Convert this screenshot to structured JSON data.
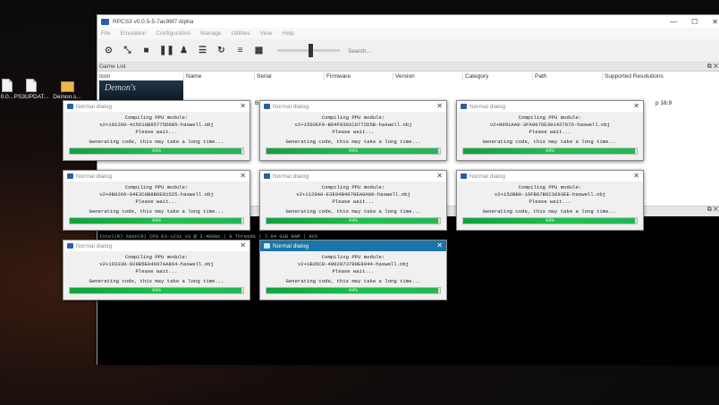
{
  "desktop": {
    "icons": [
      {
        "label": "0.0..."
      },
      {
        "label": "PS3UPDAT..."
      },
      {
        "label": "Demon.s..."
      }
    ]
  },
  "window": {
    "title": "RPCS3 v0.0.5-5-7ac96f7 Alpha",
    "controls": {
      "minimize": "—",
      "maximize": "☐",
      "close": "✕"
    }
  },
  "menu": [
    "File",
    "Emulation",
    "Configuration",
    "Manage",
    "Utilities",
    "View",
    "Help"
  ],
  "toolbar": {
    "search_placeholder": "Search...",
    "icons": [
      "open-icon",
      "fullscreen-icon",
      "stop-icon",
      "pause-icon",
      "user-icon",
      "settings-icon",
      "refresh-icon",
      "list-view-icon",
      "grid-view-icon"
    ]
  },
  "game_list": {
    "dock_title": "Game List",
    "dock_buttons": "⧉ ✕",
    "columns": [
      "Icon",
      "Name",
      "Serial",
      "Firmware",
      "Version",
      "Category",
      "Path",
      "Supported Resolutions"
    ],
    "first_row": {
      "thumb_text": "Demon's",
      "name_fragment": "B",
      "resolution_fragment": "p 16:9"
    }
  },
  "log": {
    "dock_buttons": "⧉ ✕",
    "line": "Intel(R) Xeon(R) CPU E3-1231 v3 @ 3.40GHz | 8 Threads | 7.94 GiB RAM | AVX"
  },
  "dialogs": [
    {
      "title": "Normal dialog",
      "line1": "Compiling PPU module:",
      "module": "v2+101200-415616B95775D6B5-haswell.obj",
      "line3": "Please wait...",
      "line4": "Generating code, this may take a long time...",
      "progress_text": "99%",
      "progress": 0.99,
      "active": false
    },
    {
      "title": "Normal dialog",
      "line1": "Compiling PPU module:",
      "module": "v2+1502EF0-B64F9391C9772D5B-haswell.obj",
      "line3": "Please wait...",
      "line4": "Generating code, this may take a long time...",
      "progress_text": "99%",
      "progress": 0.99,
      "active": false
    },
    {
      "title": "Normal dialog",
      "line1": "Compiling PPU module:",
      "module": "v2+0091AA0-3FA9076E30142787D-haswell.obj",
      "line3": "Please wait...",
      "line4": "Generating code, this may take a long time...",
      "progress_text": "99%",
      "progress": 0.99,
      "active": false
    },
    {
      "title": "Normal dialog",
      "line1": "Compiling PPU module:",
      "module": "v2+0B0260-84E3C8B8B6E01525-haswell.obj",
      "line3": "Please wait...",
      "line4": "Generating code, this may take a long time...",
      "progress_text": "99%",
      "progress": 0.99,
      "active": false
    },
    {
      "title": "Normal dialog",
      "line1": "Compiling PPU module:",
      "module": "v2+1129A0-E3E94B4870EA0A90-haswell.obj",
      "line3": "Please wait...",
      "line4": "Generating code, this may take a long time...",
      "progress_text": "99%",
      "progress": 0.99,
      "active": false
    },
    {
      "title": "Normal dialog",
      "line1": "Compiling PPU module:",
      "module": "v2+152BB0-16FB67B6C3693EE-haswell.obj",
      "line3": "Please wait...",
      "line4": "Generating code, this may take a long time...",
      "progress_text": "99%",
      "progress": 0.99,
      "active": false
    },
    {
      "title": "Normal dialog",
      "line1": "Compiling PPU module:",
      "module": "v2+193330-928B5EA4697AA864-haswell.obj",
      "line3": "Please wait...",
      "line4": "Generating code, this may take a long time...",
      "progress_text": "99%",
      "progress": 0.99,
      "active": false
    },
    {
      "title": "Normal dialog",
      "line1": "Compiling PPU module:",
      "module": "v2+1B35C8-4002073789E8944-haswell.obj",
      "line3": "Please wait...",
      "line4": "Generating code, this may take a long time...",
      "progress_text": "99%",
      "progress": 0.99,
      "active": true
    }
  ],
  "colors": {
    "progress_fill": "#1ec24e",
    "active_titlebar": "#1a75a8",
    "desktop": "#0b0b0e"
  }
}
